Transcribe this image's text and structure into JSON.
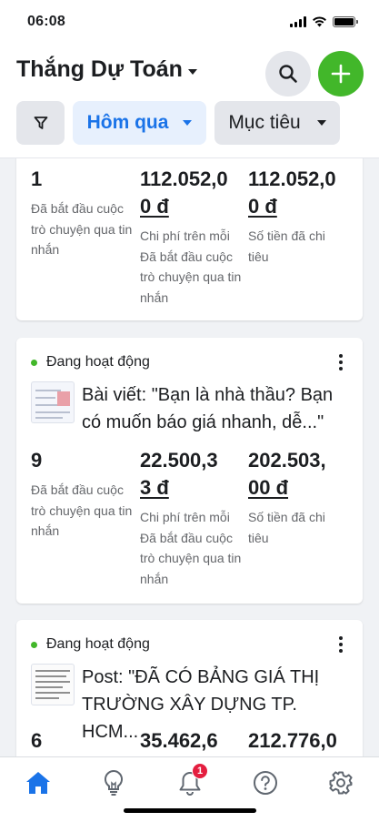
{
  "status_bar": {
    "time": "06:08"
  },
  "header": {
    "account_name": "Thắng Dự Toán",
    "filters": {
      "date_label": "Hôm qua",
      "objective_label": "Mục tiêu"
    }
  },
  "colors": {
    "accent": "#1a73e8",
    "add_button": "#42b72a",
    "active_dot": "#42b72a",
    "badge": "#e41e3f"
  },
  "cards": [
    {
      "metrics": [
        {
          "value": "1",
          "label": "Đã bắt đầu cuộc trò chuyện qua tin nhắn"
        },
        {
          "value_lines": [
            "112.052,0",
            "0 đ"
          ],
          "label": "Chi phí trên mỗi Đã bắt đầu cuộc trò chuyện qua tin nhắn"
        },
        {
          "value_lines": [
            "112.052,0",
            "0 đ"
          ],
          "label": "Số tiền đã chi tiêu"
        }
      ]
    },
    {
      "status": "Đang hoạt động",
      "title": "Bài viết: \"Bạn là nhà thầu? Bạn có muốn báo giá nhanh, dễ...\"",
      "metrics": [
        {
          "value": "9",
          "label": "Đã bắt đầu cuộc trò chuyện qua tin nhắn"
        },
        {
          "value_lines": [
            "22.500,3",
            "3 đ"
          ],
          "label": "Chi phí trên mỗi Đã bắt đầu cuộc trò chuyện qua tin nhắn"
        },
        {
          "value_lines": [
            "202.503,",
            "00 đ"
          ],
          "label": "Số tiền đã chi tiêu"
        }
      ]
    },
    {
      "status": "Đang hoạt động",
      "title": "Post: \"ĐÃ CÓ BẢNG GIÁ THỊ TRƯỜNG XÂY DỰNG TP. HCM...",
      "metrics": [
        {
          "value": "6"
        },
        {
          "value_lines": [
            "35.462,6"
          ]
        },
        {
          "value_lines": [
            "212.776,0"
          ]
        }
      ]
    }
  ],
  "bottom_nav": {
    "items": [
      "home-icon",
      "lightbulb-icon",
      "bell-icon",
      "help-icon",
      "settings-icon"
    ],
    "notification_count": "1"
  }
}
